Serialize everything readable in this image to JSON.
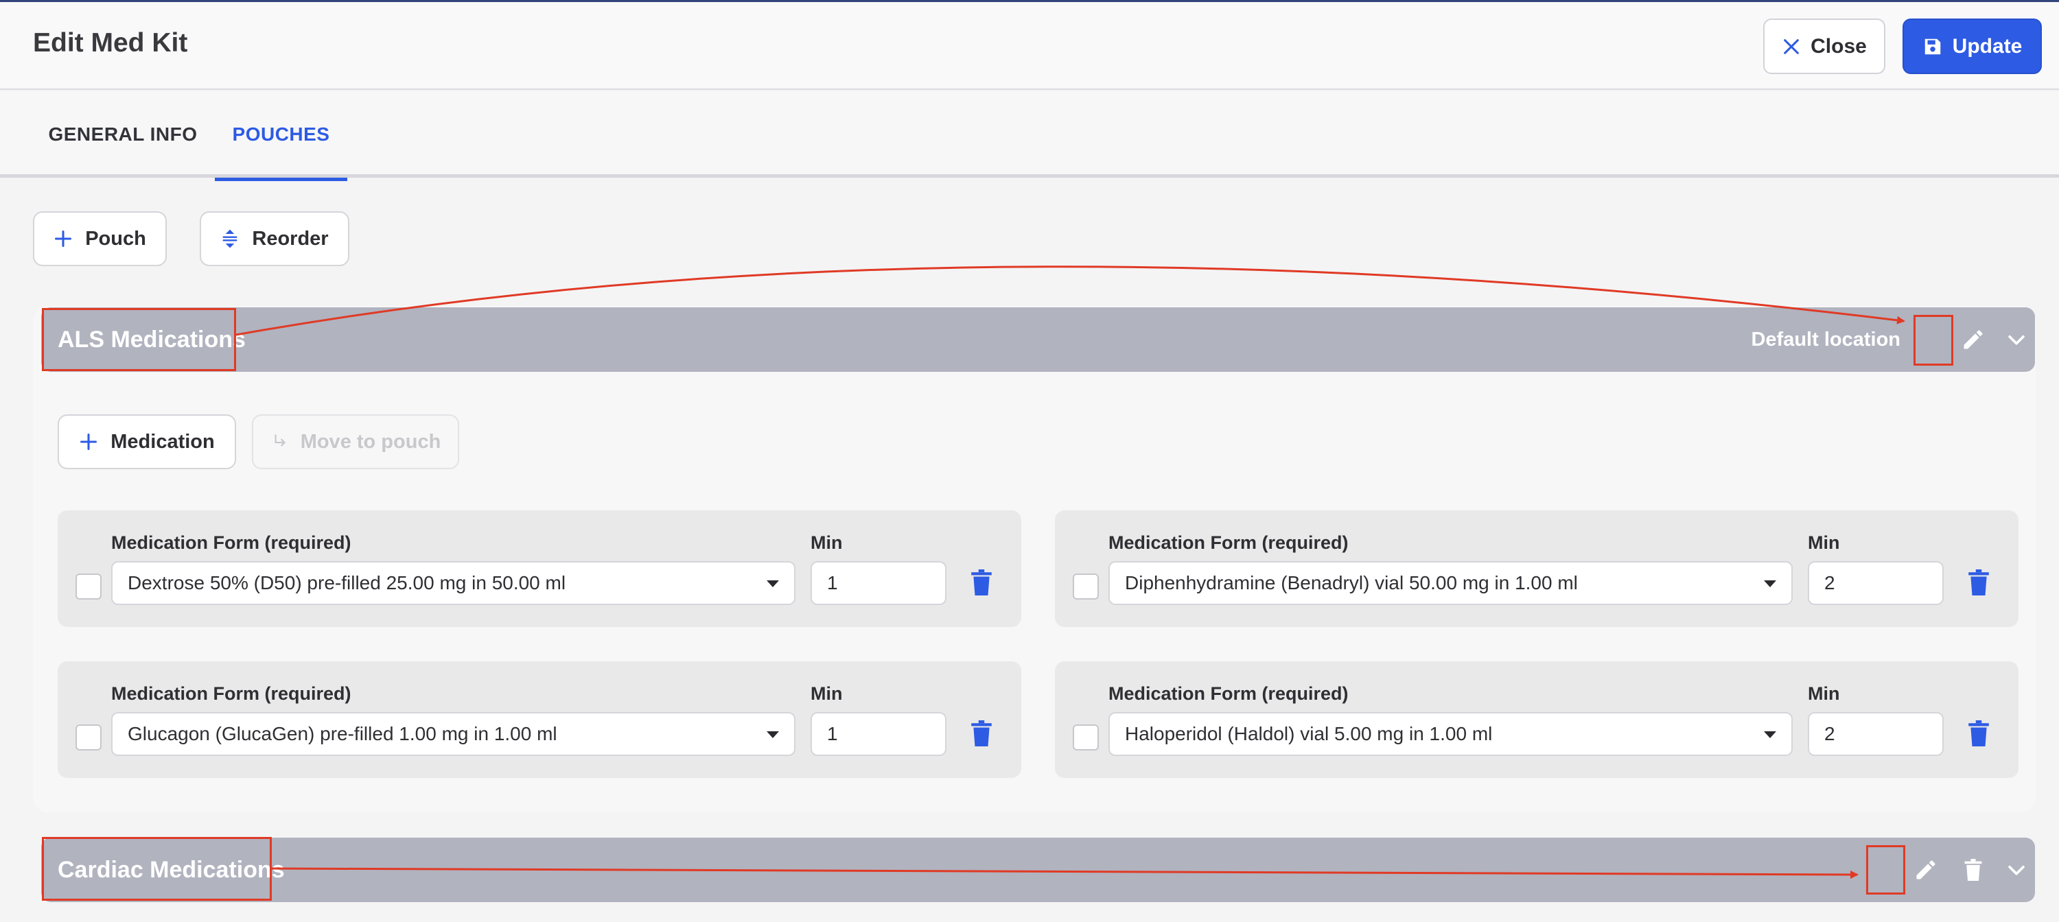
{
  "header": {
    "title": "Edit Med Kit",
    "close_label": "Close",
    "update_label": "Update"
  },
  "tabs": [
    {
      "label": "GENERAL INFO",
      "active": false
    },
    {
      "label": "POUCHES",
      "active": true
    }
  ],
  "actions": {
    "pouch_label": "Pouch",
    "reorder_label": "Reorder"
  },
  "pouches": [
    {
      "name": "ALS Medications",
      "location": "Default location",
      "add_medication_label": "Medication",
      "move_to_pouch_label": "Move to pouch",
      "medications": [
        {
          "form_label": "Medication Form (required)",
          "form": "Dextrose 50% (D50) pre-filled 25.00 mg in 50.00 ml",
          "min_label": "Min",
          "min": "1"
        },
        {
          "form_label": "Medication Form (required)",
          "form": "Diphenhydramine (Benadryl) vial 50.00 mg in 1.00 ml",
          "min_label": "Min",
          "min": "2"
        },
        {
          "form_label": "Medication Form (required)",
          "form": "Glucagon (GlucaGen) pre-filled 1.00 mg in 1.00 ml",
          "min_label": "Min",
          "min": "1"
        },
        {
          "form_label": "Medication Form (required)",
          "form": "Haloperidol (Haldol) vial 5.00 mg in 1.00 ml",
          "min_label": "Min",
          "min": "2"
        }
      ]
    },
    {
      "name": "Cardiac Medications"
    }
  ],
  "icons": {
    "close": "close-icon",
    "save": "save-icon",
    "plus": "plus-icon",
    "reorder": "reorder-icon",
    "edit": "pencil-icon",
    "delete": "trash-icon",
    "expand": "chevron-down-icon",
    "move": "move-arrow-icon"
  },
  "colors": {
    "accent": "#2d5be3",
    "pouch_bar": "#b1b3bf",
    "annotation": "#e03a25"
  }
}
